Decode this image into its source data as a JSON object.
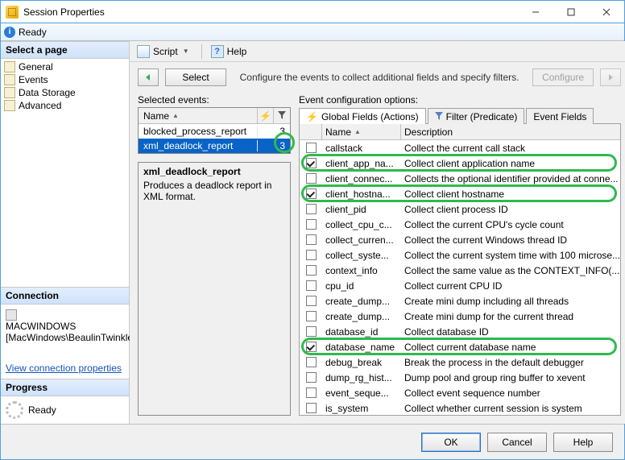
{
  "window": {
    "title": "Session Properties"
  },
  "status": {
    "ready": "Ready"
  },
  "left": {
    "select_page": "Select a page",
    "pages": [
      "General",
      "Events",
      "Data Storage",
      "Advanced"
    ],
    "connection_head": "Connection",
    "server": "MACWINDOWS",
    "login": "[MacWindows\\BeaulinTwinkle]",
    "view_conn": "View connection properties",
    "progress_head": "Progress",
    "progress_state": "Ready"
  },
  "toolbar": {
    "script": "Script",
    "help": "Help"
  },
  "nav": {
    "select": "Select",
    "instructions": "Configure the events to collect additional fields and specify filters.",
    "configure": "Configure"
  },
  "selected_events": {
    "label": "Selected events:",
    "header_name": "Name",
    "rows": [
      {
        "name": "blocked_process_report",
        "count": "3",
        "selected": false
      },
      {
        "name": "xml_deadlock_report",
        "count": "3",
        "selected": true
      }
    ]
  },
  "desc": {
    "title": "xml_deadlock_report",
    "text": "Produces a deadlock report in XML format."
  },
  "event_cfg": {
    "label": "Event configuration options:",
    "tabs": {
      "global": "Global Fields (Actions)",
      "filter": "Filter (Predicate)",
      "fields": "Event Fields"
    },
    "header_name": "Name",
    "header_desc": "Description"
  },
  "fields": [
    {
      "checked": false,
      "name": "callstack",
      "desc": "Collect the current call stack",
      "hl": false
    },
    {
      "checked": true,
      "name": "client_app_na...",
      "desc": "Collect client application name",
      "hl": true
    },
    {
      "checked": false,
      "name": "client_connec...",
      "desc": "Collects the optional identifier provided at conne...",
      "hl": false
    },
    {
      "checked": true,
      "name": "client_hostna...",
      "desc": "Collect client hostname",
      "hl": true
    },
    {
      "checked": false,
      "name": "client_pid",
      "desc": "Collect client process ID",
      "hl": false
    },
    {
      "checked": false,
      "name": "collect_cpu_c...",
      "desc": "Collect the current CPU's cycle count",
      "hl": false
    },
    {
      "checked": false,
      "name": "collect_curren...",
      "desc": "Collect the current Windows thread ID",
      "hl": false
    },
    {
      "checked": false,
      "name": "collect_syste...",
      "desc": "Collect the current system time with 100 microse...",
      "hl": false
    },
    {
      "checked": false,
      "name": "context_info",
      "desc": "Collect the same value as the CONTEXT_INFO(...",
      "hl": false
    },
    {
      "checked": false,
      "name": "cpu_id",
      "desc": "Collect current CPU ID",
      "hl": false
    },
    {
      "checked": false,
      "name": "create_dump...",
      "desc": "Create mini dump including all threads",
      "hl": false
    },
    {
      "checked": false,
      "name": "create_dump...",
      "desc": "Create mini dump for the current thread",
      "hl": false
    },
    {
      "checked": false,
      "name": "database_id",
      "desc": "Collect database ID",
      "hl": false
    },
    {
      "checked": true,
      "name": "database_name",
      "desc": "Collect current database name",
      "hl": true
    },
    {
      "checked": false,
      "name": "debug_break",
      "desc": "Break the process in the default debugger",
      "hl": false
    },
    {
      "checked": false,
      "name": "dump_rg_hist...",
      "desc": "Dump pool and group ring buffer to xevent",
      "hl": false
    },
    {
      "checked": false,
      "name": "event_seque...",
      "desc": "Collect event sequence number",
      "hl": false
    },
    {
      "checked": false,
      "name": "is_system",
      "desc": "Collect whether current session is system",
      "hl": false
    }
  ],
  "footer": {
    "ok": "OK",
    "cancel": "Cancel",
    "help": "Help"
  }
}
